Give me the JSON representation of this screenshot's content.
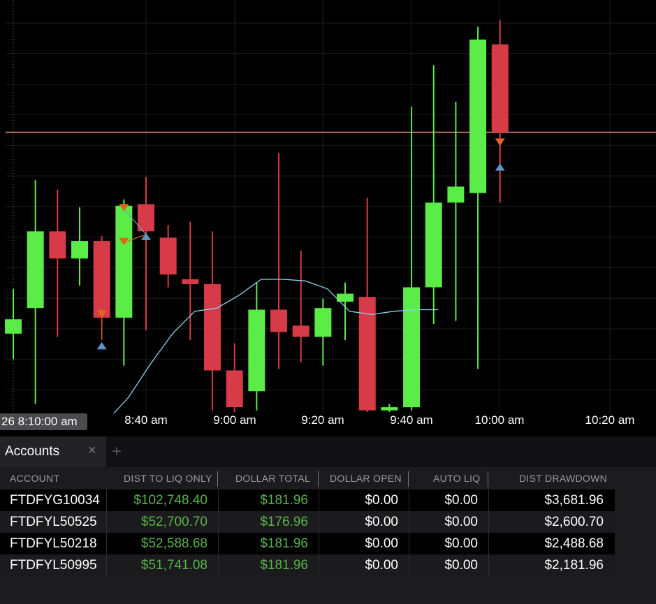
{
  "chart_data": {
    "type": "candlestick",
    "cursor_time": "26 8:10:00 am",
    "x_tick_labels": [
      "8:40 am",
      "9:00 am",
      "9:20 am",
      "9:40 am",
      "10:00 am",
      "10:20 am"
    ],
    "up_color": "#5cec47",
    "down_color": "#d63b47",
    "ma_color": "#8fd4ee",
    "price_line_color": "#e98b7c",
    "marker_sell_color": "#e0661f",
    "marker_buy_color": "#5896c9",
    "candles": [
      {
        "open": 80.0,
        "close": 84.5,
        "high": 94.0,
        "low": 72.0
      },
      {
        "open": 88.0,
        "close": 112.0,
        "high": 128.0,
        "low": 58.0
      },
      {
        "open": 112.0,
        "close": 103.5,
        "high": 125.0,
        "low": 79.0
      },
      {
        "open": 103.5,
        "close": 109.0,
        "high": 119.5,
        "low": 95.0
      },
      {
        "open": 109.0,
        "close": 85.0,
        "high": 110.5,
        "low": 83.5
      },
      {
        "open": 85.0,
        "close": 120.0,
        "high": 122.0,
        "low": 70.0
      },
      {
        "open": 120.5,
        "close": 112.0,
        "high": 129.0,
        "low": 81.0
      },
      {
        "open": 110.0,
        "close": 98.5,
        "high": 114.0,
        "low": 94.5
      },
      {
        "open": 97.0,
        "close": 95.5,
        "high": 115.0,
        "low": 78.0
      },
      {
        "open": 95.5,
        "close": 68.5,
        "high": 112.0,
        "low": 56.0
      },
      {
        "open": 68.5,
        "close": 57.0,
        "high": 77.0,
        "low": 55.5
      },
      {
        "open": 62.0,
        "close": 87.5,
        "high": 96.0,
        "low": 56.0
      },
      {
        "open": 87.5,
        "close": 80.5,
        "high": 136.5,
        "low": 69.0
      },
      {
        "open": 82.5,
        "close": 79.0,
        "high": 106.0,
        "low": 71.0
      },
      {
        "open": 79.0,
        "close": 88.0,
        "high": 91.0,
        "low": 70.0
      },
      {
        "open": 90.0,
        "close": 92.5,
        "high": 96.0,
        "low": 78.0
      },
      {
        "open": 91.5,
        "close": 56.0,
        "high": 122.5,
        "low": 55.5
      },
      {
        "open": 56.0,
        "close": 57.0,
        "high": 58.0,
        "low": 55.5
      },
      {
        "open": 57.0,
        "close": 94.5,
        "high": 151.0,
        "low": 56.0
      },
      {
        "open": 94.5,
        "close": 121.0,
        "high": 164.0,
        "low": 83.0
      },
      {
        "open": 121.0,
        "close": 126.0,
        "high": 152.5,
        "low": 84.0
      },
      {
        "open": 124.0,
        "close": 172.0,
        "high": 176.0,
        "low": 69.0
      },
      {
        "open": 170.5,
        "close": 143.0,
        "high": 178.0,
        "low": 121.0
      }
    ],
    "ma": [
      52.5,
      60.0,
      70.5,
      80.0,
      87.0,
      88.0,
      92.0,
      97.0,
      97.0,
      96.5,
      94.0,
      87.0,
      86.0,
      87.0,
      87.5,
      87.5
    ],
    "price_line": 143.0,
    "y_range": [
      55.5,
      180.0
    ],
    "grid": true
  },
  "accounts_panel": {
    "tab_label": "Accounts",
    "close_symbol": "×",
    "add_symbol": "+",
    "columns": [
      "ACCOUNT",
      "DIST TO LIQ ONLY",
      "DOLLAR TOTAL",
      "DOLLAR OPEN",
      "AUTO LIQ",
      "DIST DRAWDOWN"
    ],
    "rows": [
      {
        "account": "FTDFYG10034",
        "dist_to_liq": "$102,748.40",
        "dollar_total": "$181.96",
        "dollar_open": "$0.00",
        "auto_liq": "$0.00",
        "dist_drawdown": "$3,681.96"
      },
      {
        "account": "FTDFYL50525",
        "dist_to_liq": "$52,700.70",
        "dollar_total": "$176.96",
        "dollar_open": "$0.00",
        "auto_liq": "$0.00",
        "dist_drawdown": "$2,600.70"
      },
      {
        "account": "FTDFYL50218",
        "dist_to_liq": "$52,588.68",
        "dollar_total": "$181.96",
        "dollar_open": "$0.00",
        "auto_liq": "$0.00",
        "dist_drawdown": "$2,488.68"
      },
      {
        "account": "FTDFYL50995",
        "dist_to_liq": "$51,741.08",
        "dollar_total": "$181.96",
        "dollar_open": "$0.00",
        "auto_liq": "$0.00",
        "dist_drawdown": "$2,181.96"
      }
    ]
  }
}
